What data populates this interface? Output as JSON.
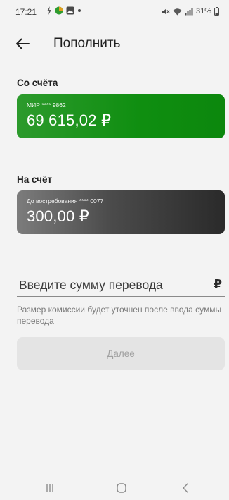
{
  "status_bar": {
    "time": "17:21",
    "battery": "31%",
    "icons": [
      "sync-icon",
      "app-dot-icon",
      "gallery-icon",
      "notification-dot-icon",
      "mute-icon",
      "wifi-icon",
      "signal-icon",
      "battery-icon"
    ]
  },
  "header": {
    "title": "Пополнить",
    "back_icon": "arrow-left-icon"
  },
  "from_section": {
    "label": "Со счёта",
    "card": {
      "name": "МИР **** 9862",
      "amount": "69 615,02 ₽",
      "color": "#0c8e0c"
    }
  },
  "to_section": {
    "label": "На счёт",
    "card": {
      "name": "До востребования **** 0077",
      "amount": "300,00 ₽",
      "color": "#3a3a3a"
    }
  },
  "amount_input": {
    "placeholder": "Введите сумму перевода",
    "value": "",
    "currency": "₽"
  },
  "fee_note": "Размер комиссии будет уточнен после ввода суммы перевода",
  "next_button": {
    "label": "Далее",
    "enabled": false
  },
  "nav_bar": {
    "items": [
      "recent-apps-icon",
      "home-icon",
      "back-icon"
    ]
  }
}
